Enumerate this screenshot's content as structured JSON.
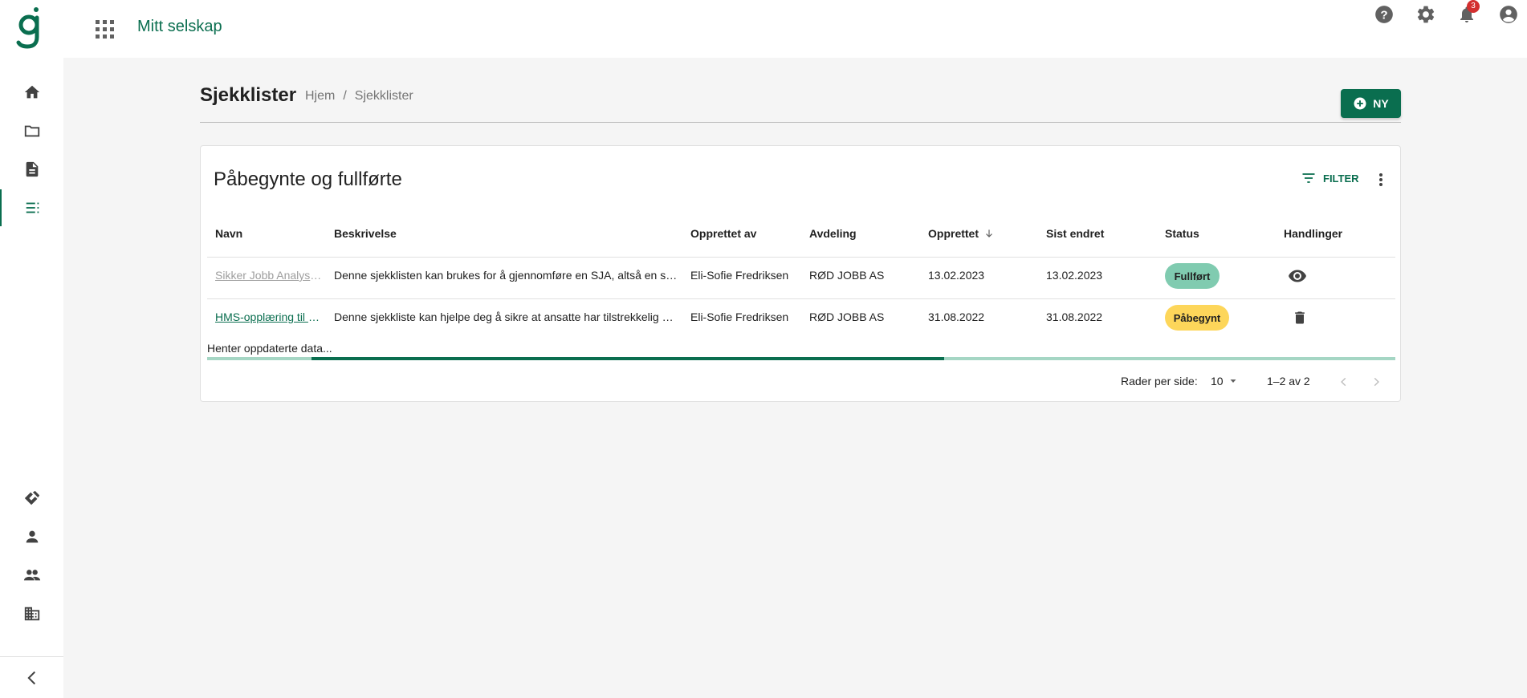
{
  "app": {
    "company_name": "Mitt selskap",
    "notification_count": "3",
    "colors": {
      "brand": "#0a6e4f",
      "completed": "#80cbb0",
      "started": "#fdd65a",
      "danger": "#d32f2f"
    }
  },
  "top_icons": [
    "help-icon",
    "settings-icon",
    "notifications-icon",
    "account-icon"
  ],
  "sidebar": {
    "items": [
      {
        "name": "home-icon"
      },
      {
        "name": "folder-icon"
      },
      {
        "name": "document-icon"
      },
      {
        "name": "checklist-icon",
        "active": true
      },
      {
        "name": "handshake-icon"
      },
      {
        "name": "person-icon"
      },
      {
        "name": "people-icon"
      },
      {
        "name": "building-icon"
      }
    ],
    "collapse_icon": "chevron-left-icon"
  },
  "page": {
    "title": "Sjekklister",
    "breadcrumb": [
      "Hjem",
      "/",
      "Sjekklister"
    ],
    "new_button": "NY"
  },
  "card": {
    "title": "Påbegynte og fullførte",
    "filter_label": "FILTER",
    "columns": [
      "Navn",
      "Beskrivelse",
      "Opprettet av",
      "Avdeling",
      "Opprettet",
      "Sist endret",
      "Status",
      "Handlinger"
    ],
    "sorted_column": "Opprettet",
    "rows": [
      {
        "name": "Sikker Jobb Analyse (SJA)",
        "description": "Denne sjekklisten kan brukes for å gjennomføre en SJA, altså en sikker jobb analyse",
        "created_by": "Eli-Sofie Fredriksen",
        "department": "RØD JOBB AS",
        "created": "13.02.2023",
        "modified": "13.02.2023",
        "status": "Fullført",
        "action": "view-icon"
      },
      {
        "name": "HMS-opplæring til ansatte",
        "description": "Denne sjekkliste kan hjelpe deg å sikre at ansatte har tilstrekkelig opplæring",
        "created_by": "Eli-Sofie Fredriksen",
        "department": "RØD JOBB AS",
        "created": "31.08.2022",
        "modified": "31.08.2022",
        "status": "Påbegynt",
        "action": "delete-icon"
      }
    ],
    "loading_text": "Henter oppdaterte data...",
    "progress": {
      "start": 0.088,
      "end": 0.62
    },
    "pagination": {
      "rows_per_page_label": "Rader per side:",
      "rows_per_page": "10",
      "range": "1–2 av 2"
    }
  }
}
